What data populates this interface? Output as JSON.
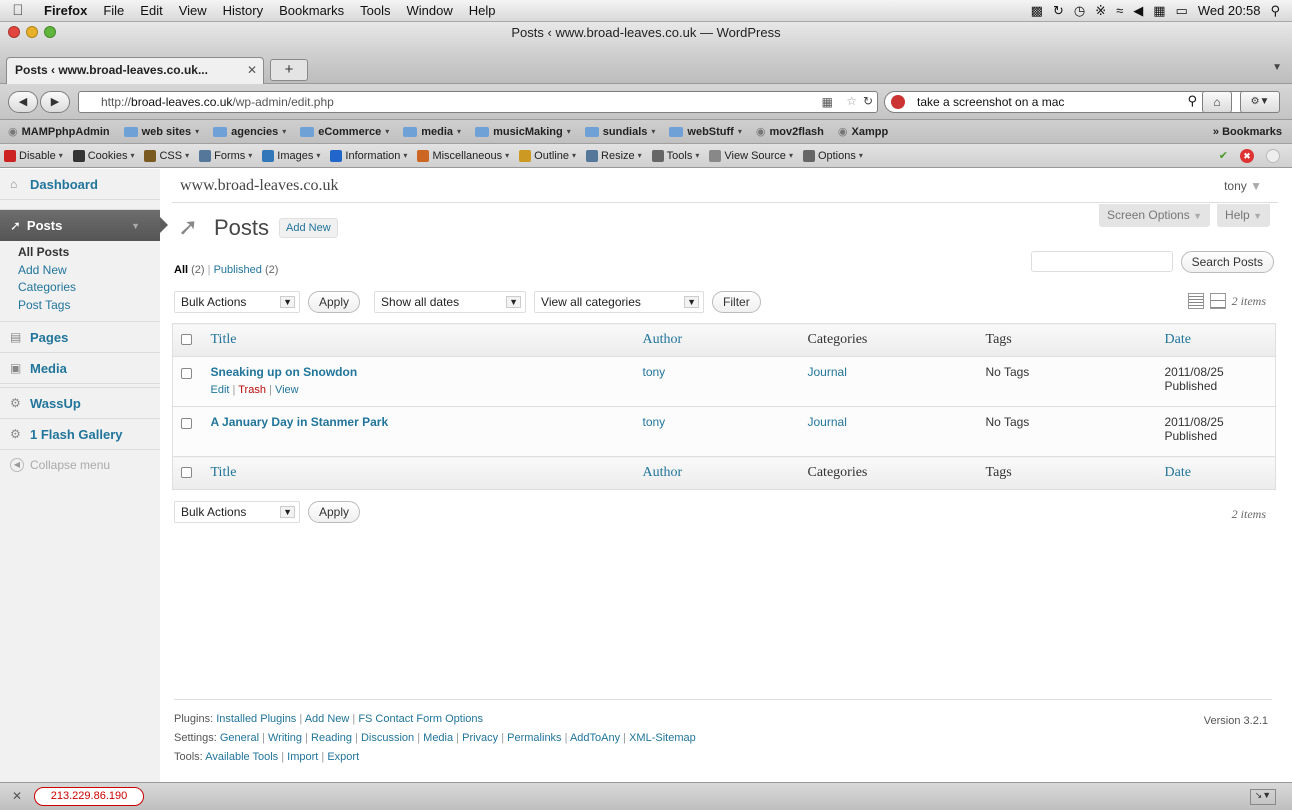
{
  "menubar": {
    "app": "Firefox",
    "items": [
      "File",
      "Edit",
      "View",
      "History",
      "Bookmarks",
      "Tools",
      "Window",
      "Help"
    ],
    "clock": "Wed 20:58"
  },
  "window": {
    "title": "Posts ‹ www.broad-leaves.co.uk — WordPress",
    "tab_label": "Posts ‹ www.broad-leaves.co.uk..."
  },
  "navbar": {
    "url_prefix": "http://",
    "url_host": "broad-leaves.co.uk",
    "url_path": "/wp-admin/edit.php",
    "search_value": "take a screenshot on a mac"
  },
  "bookmarks": {
    "items": [
      {
        "label": "MAMPphpAdmin",
        "folder": false
      },
      {
        "label": "web sites",
        "folder": true
      },
      {
        "label": "agencies",
        "folder": true
      },
      {
        "label": "eCommerce",
        "folder": true
      },
      {
        "label": "media",
        "folder": true
      },
      {
        "label": "musicMaking",
        "folder": true
      },
      {
        "label": "sundials",
        "folder": true
      },
      {
        "label": "webStuff",
        "folder": true
      },
      {
        "label": "mov2flash",
        "folder": false
      },
      {
        "label": "Xampp",
        "folder": false
      }
    ],
    "right_label": "Bookmarks"
  },
  "devbar": {
    "items": [
      "Disable",
      "Cookies",
      "CSS",
      "Forms",
      "Images",
      "Information",
      "Miscellaneous",
      "Outline",
      "Resize",
      "Tools",
      "View Source",
      "Options"
    ],
    "icon_colors": [
      "#cc2222",
      "#333333",
      "#7a5a20",
      "#557799",
      "#3377bb",
      "#2266cc",
      "#cc6622",
      "#cc9922",
      "#557799",
      "#666666",
      "#888888",
      "#666666"
    ]
  },
  "wp": {
    "site_name": "www.broad-leaves.co.uk",
    "user": "tony",
    "screen_options": "Screen Options",
    "help": "Help",
    "menu": {
      "dashboard": "Dashboard",
      "posts": "Posts",
      "posts_sub": [
        "All Posts",
        "Add New",
        "Categories",
        "Post Tags"
      ],
      "pages": "Pages",
      "media": "Media",
      "wassup": "WassUp",
      "flash_gallery": "1 Flash Gallery",
      "collapse": "Collapse menu"
    },
    "page_title": "Posts",
    "add_new": "Add New",
    "filters": {
      "all_label": "All",
      "all_count": "(2)",
      "published_label": "Published",
      "published_count": "(2)",
      "bulk_actions": "Bulk Actions",
      "apply": "Apply",
      "dates": "Show all dates",
      "categories": "View all categories",
      "filter": "Filter",
      "search_button": "Search Posts",
      "item_count": "2 items"
    },
    "table": {
      "columns": [
        "Title",
        "Author",
        "Categories",
        "Tags",
        "Date"
      ],
      "rows": [
        {
          "title": "Sneaking up on Snowdon",
          "author": "tony",
          "category": "Journal",
          "tags": "No Tags",
          "date": "2011/08/25",
          "status": "Published",
          "actions": [
            "Edit",
            "Trash",
            "View"
          ]
        },
        {
          "title": "A January Day in Stanmer Park",
          "author": "tony",
          "category": "Journal",
          "tags": "No Tags",
          "date": "2011/08/25",
          "status": "Published",
          "actions": []
        }
      ]
    },
    "footer": {
      "plugins_label": "Plugins:",
      "plugins_links": [
        "Installed Plugins",
        "Add New",
        "FS Contact Form Options"
      ],
      "settings_label": "Settings:",
      "settings_links": [
        "General",
        "Writing",
        "Reading",
        "Discussion",
        "Media",
        "Privacy",
        "Permalinks",
        "AddToAny",
        "XML-Sitemap"
      ],
      "tools_label": "Tools:",
      "tools_links": [
        "Available Tools",
        "Import",
        "Export"
      ],
      "version": "Version 3.2.1"
    }
  },
  "statusbar": {
    "ip": "213.229.86.190"
  }
}
